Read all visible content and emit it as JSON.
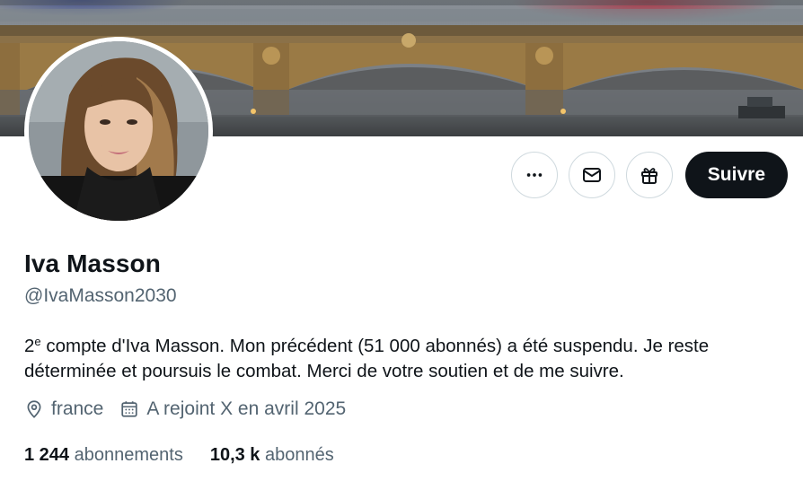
{
  "profile": {
    "name": "Iva Masson",
    "handle": "@IvaMasson2030",
    "bio_prefix": "2",
    "bio_superscript": "e",
    "bio_rest": " compte d'Iva Masson. Mon précédent (51 000 abonnés) a été suspendu. Je reste déterminée et poursuis le combat. Merci de votre soutien et de me suivre.",
    "location": "france",
    "joined": "A rejoint X en avril 2025"
  },
  "actions": {
    "more_icon": "more-dots-icon",
    "message_icon": "envelope-icon",
    "gift_icon": "gift-icon",
    "follow_label": "Suivre"
  },
  "stats": {
    "following_count": "1 244",
    "following_label": "abonnements",
    "followers_count": "10,3 k",
    "followers_label": "abonnés"
  },
  "colors": {
    "text": "#0f1419",
    "secondary": "#536471",
    "border": "#cfd9de",
    "follow_bg": "#0f1419"
  }
}
